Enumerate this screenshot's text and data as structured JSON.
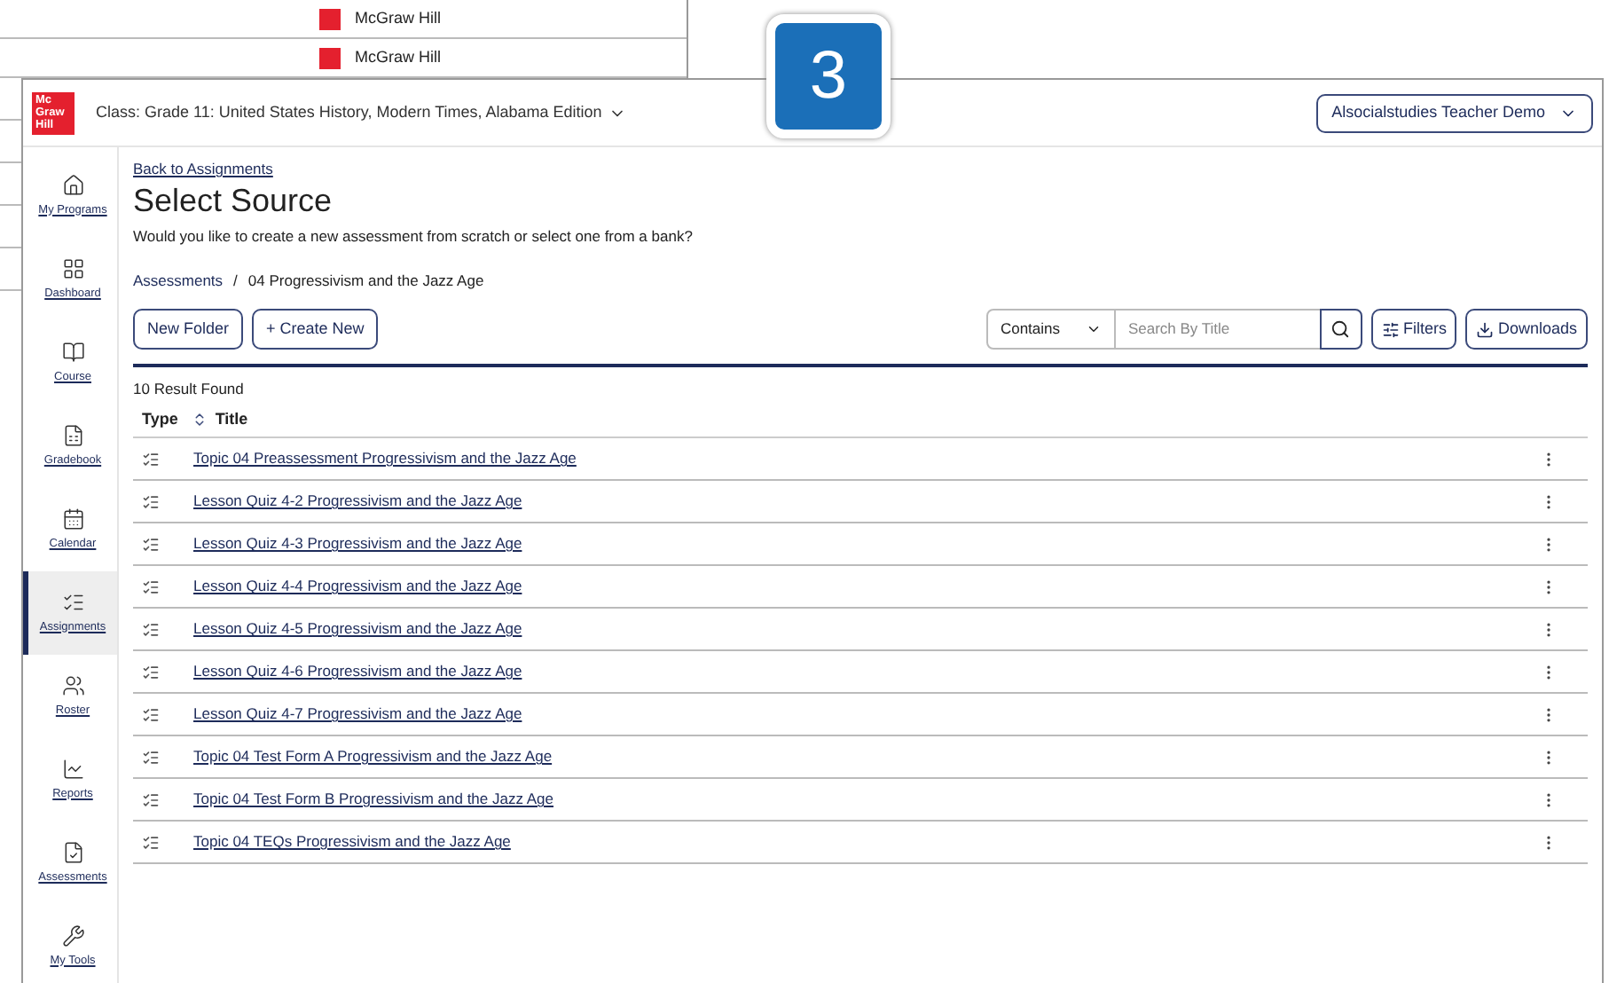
{
  "background_window": {
    "items": [
      "McGraw Hill",
      "McGraw Hill"
    ]
  },
  "step_badge": "3",
  "header": {
    "logo": [
      "Mc",
      "Graw",
      "Hill"
    ],
    "class_label": "Class: Grade 11: United States History, Modern Times, Alabama Edition",
    "user_menu": "Alsocialstudies Teacher Demo"
  },
  "sidebar": {
    "items": [
      {
        "label": "My Programs",
        "selected": false
      },
      {
        "label": "Dashboard",
        "selected": false
      },
      {
        "label": "Course",
        "selected": false
      },
      {
        "label": "Gradebook",
        "selected": false
      },
      {
        "label": "Calendar",
        "selected": false
      },
      {
        "label": "Assignments",
        "selected": true
      },
      {
        "label": "Roster",
        "selected": false
      },
      {
        "label": "Reports",
        "selected": false
      },
      {
        "label": "Assessments",
        "selected": false
      },
      {
        "label": "My Tools",
        "selected": false
      }
    ]
  },
  "back_link": "Back to Assignments",
  "title": "Select Source",
  "subtitle": "Would you like to create a new assessment from scratch or select one from a bank?",
  "breadcrumb": [
    "Assessments",
    "04 Progressivism and the Jazz Age"
  ],
  "breadcrumb_separator": "/",
  "actions": [
    "New Folder",
    "+ Create New"
  ],
  "search": {
    "match_mode": "Contains",
    "placeholder": "Search By Title"
  },
  "tool_buttons": [
    "Filters",
    "Downloads"
  ],
  "result_count": "10 Result Found",
  "table": {
    "columns": [
      "Type",
      "Title"
    ],
    "rows": [
      "Topic 04 Preassessment Progressivism and the Jazz Age",
      "Lesson Quiz 4-2 Progressivism and the Jazz Age",
      "Lesson Quiz 4-3 Progressivism and the Jazz Age",
      "Lesson Quiz 4-4 Progressivism and the Jazz Age",
      "Lesson Quiz 4-5 Progressivism and the Jazz Age",
      "Lesson Quiz 4-6 Progressivism and the Jazz Age",
      "Lesson Quiz 4-7 Progressivism and the Jazz Age",
      "Topic 04 Test Form A Progressivism and the Jazz Age",
      "Topic 04 Test Form B Progressivism and the Jazz Age",
      "Topic 04 TEQs Progressivism and the Jazz Age"
    ]
  }
}
